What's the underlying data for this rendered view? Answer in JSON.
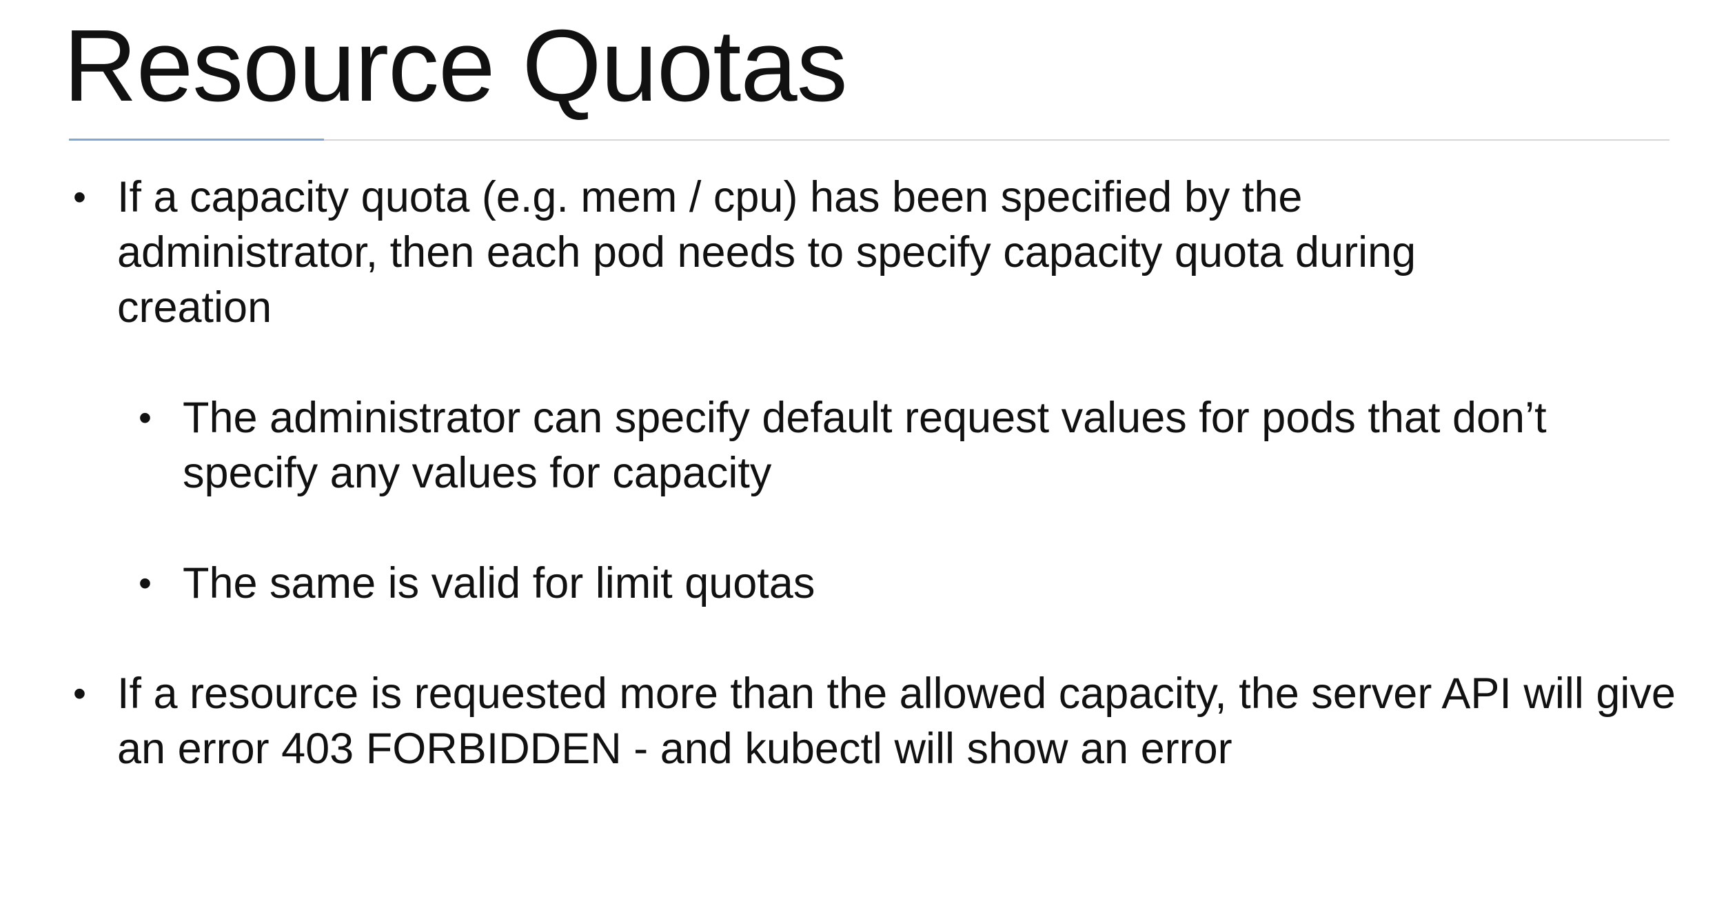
{
  "slide": {
    "title": "Resource Quotas",
    "bullets": [
      {
        "level": 1,
        "text": "If a capacity quota (e.g. mem / cpu) has been specified by the administrator, then each pod needs to specify capacity quota during creation"
      },
      {
        "level": 2,
        "text": "The administrator can specify default request values for pods that don’t specify any values for capacity"
      },
      {
        "level": 2,
        "text": "The same is valid for limit quotas"
      },
      {
        "level": 1,
        "text": "If a resource is requested more than the allowed capacity, the server API will give an error 403 FORBIDDEN - and kubectl will show an error"
      }
    ],
    "bullet_glyph": "•"
  },
  "colors": {
    "text": "#111111",
    "divider": "#d6d6d6",
    "accent": "#7fa7d6"
  }
}
